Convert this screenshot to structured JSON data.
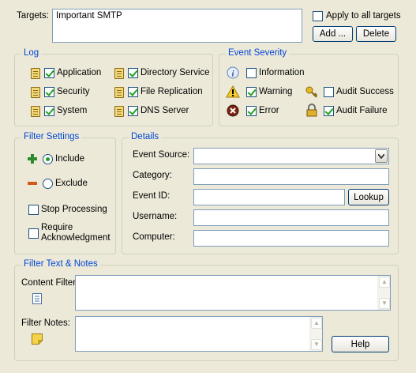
{
  "targets": {
    "label": "Targets:",
    "value": "Important SMTP",
    "apply_all_label": "Apply to all targets",
    "add_button": "Add ...",
    "delete_button": "Delete"
  },
  "log": {
    "legend": "Log",
    "items": [
      {
        "label": "Application",
        "checked": true
      },
      {
        "label": "Security",
        "checked": true
      },
      {
        "label": "System",
        "checked": true
      },
      {
        "label": "Directory Service",
        "checked": true
      },
      {
        "label": "File Replication",
        "checked": true
      },
      {
        "label": "DNS Server",
        "checked": true
      }
    ]
  },
  "severity": {
    "legend": "Event Severity",
    "items": [
      {
        "label": "Information",
        "checked": false,
        "icon": "info-icon"
      },
      {
        "label": "Warning",
        "checked": true,
        "icon": "warning-icon"
      },
      {
        "label": "Error",
        "checked": true,
        "icon": "error-icon"
      },
      {
        "label": "Audit Success",
        "checked": false,
        "icon": "key-icon"
      },
      {
        "label": "Audit Failure",
        "checked": true,
        "icon": "lock-icon"
      }
    ]
  },
  "filter_settings": {
    "legend": "Filter Settings",
    "include_label": "Include",
    "exclude_label": "Exclude",
    "selected": "include",
    "stop_processing_label": "Stop Processing",
    "require_ack_label_1": "Require",
    "require_ack_label_2": "Acknowledgment"
  },
  "details": {
    "legend": "Details",
    "event_source_label": "Event Source:",
    "event_source_value": "",
    "category_label": "Category:",
    "category_value": "",
    "event_id_label": "Event ID:",
    "event_id_value": "",
    "lookup_button": "Lookup",
    "username_label": "Username:",
    "username_value": "",
    "computer_label": "Computer:",
    "computer_value": ""
  },
  "notes": {
    "legend": "Filter Text & Notes",
    "content_filter_label": "Content Filter:",
    "content_filter_value": "",
    "filter_notes_label": "Filter Notes:",
    "filter_notes_value": "",
    "help_button": "Help"
  },
  "colors": {
    "background": "#ece9d8",
    "legend_text": "#0046d5",
    "field_border": "#7f9db9",
    "check_mark": "#21a121"
  }
}
